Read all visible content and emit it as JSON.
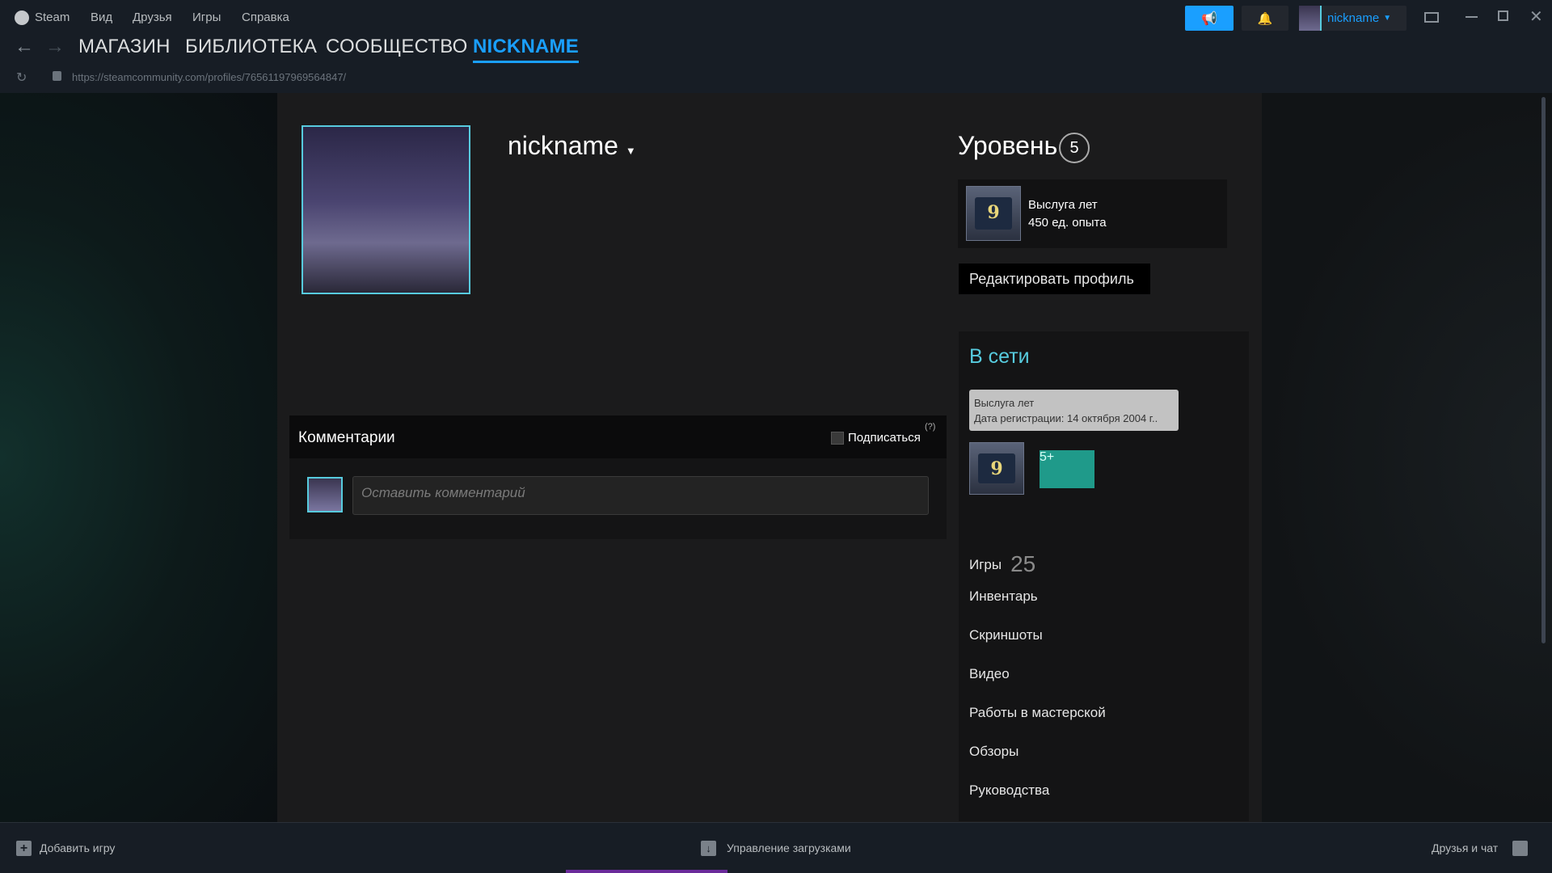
{
  "menu": {
    "app": "Steam",
    "items": [
      "Вид",
      "Друзья",
      "Игры",
      "Справка"
    ]
  },
  "nav": {
    "tabs": [
      "МАГАЗИН",
      "БИБЛИОТЕКА",
      "СООБЩЕСТВО",
      "NICKNAME"
    ],
    "active": "NICKNAME"
  },
  "url": "https://steamcommunity.com/profiles/76561197969564847/",
  "header": {
    "username": "nickname"
  },
  "profile": {
    "name": "nickname"
  },
  "level": {
    "label": "Уровень",
    "value": "5"
  },
  "xp_badge": {
    "icon_text": "9",
    "title": "Выслуга лет",
    "xp": "450 ед. опыта"
  },
  "edit_profile": "Редактировать профиль",
  "status": "В сети",
  "tooltip": {
    "title": "Выслуга лет",
    "date": "Дата регистрации: 14 октября 2004 г.."
  },
  "badges": [
    {
      "text": "9"
    },
    {
      "text": "5+"
    }
  ],
  "links": {
    "games_label": "Игры",
    "games_count": "25",
    "items": [
      "Инвентарь",
      "Скриншоты",
      "Видео",
      "Работы в мастерской",
      "Обзоры",
      "Руководства"
    ]
  },
  "comments": {
    "title": "Комментарии",
    "subscribe": "Подписаться",
    "help": "(?)",
    "placeholder": "Оставить комментарий"
  },
  "bottom": {
    "add_game": "Добавить игру",
    "downloads": "Управление загрузками",
    "friends": "Друзья и чат"
  },
  "colors": {
    "accent": "#1a9fff",
    "online": "#57cbde"
  }
}
